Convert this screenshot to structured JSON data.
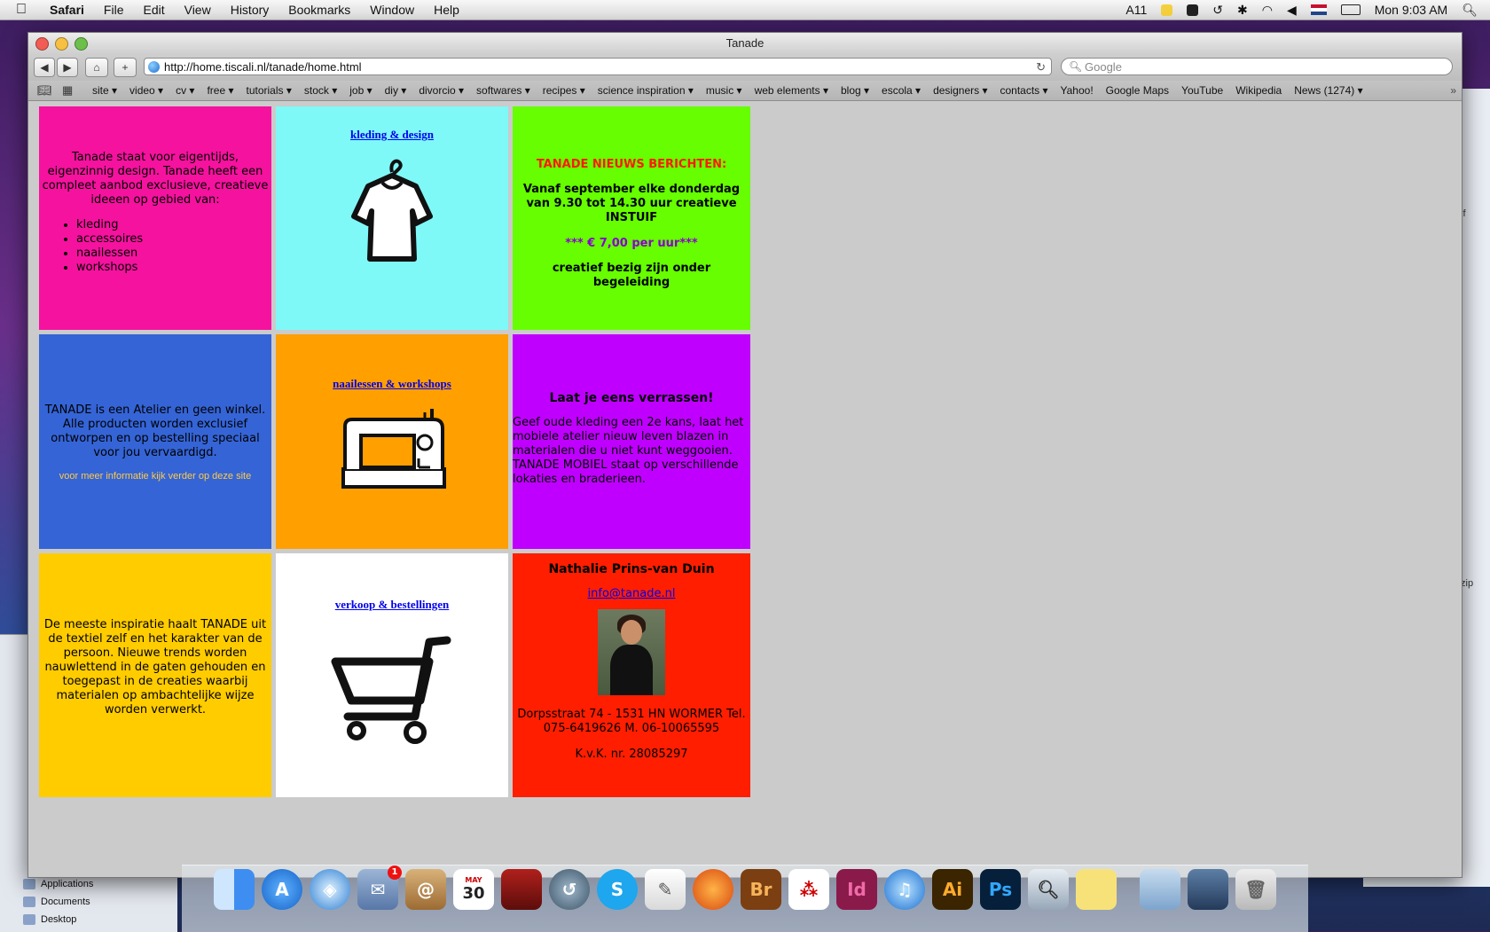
{
  "menubar": {
    "app": "Safari",
    "items": [
      "File",
      "Edit",
      "View",
      "History",
      "Bookmarks",
      "Window",
      "Help"
    ],
    "status_count": "11",
    "clock": "Mon 9:03 AM"
  },
  "window": {
    "title": "Tanade",
    "url": "http://home.tiscali.nl/tanade/home.html",
    "search_placeholder": "Google"
  },
  "bookmarks": [
    "site ▾",
    "video ▾",
    "cv ▾",
    "free ▾",
    "tutorials ▾",
    "stock ▾",
    "job ▾",
    "diy ▾",
    "divorcio ▾",
    "softwares ▾",
    "recipes ▾",
    "science inspiration ▾",
    "music ▾",
    "web elements ▾",
    "blog ▾",
    "escola ▾",
    "designers ▾",
    "contacts ▾",
    "Yahoo!",
    "Google Maps",
    "YouTube",
    "Wikipedia",
    "News (1274) ▾"
  ],
  "page": {
    "intro": "Tanade staat voor eigentijds, eigenzinnig design. Tanade heeft een compleet aanbod exclusieve, creatieve ideeen op gebied van:",
    "intro_list": [
      "kleding",
      "accessoires",
      "naailessen",
      "workshops"
    ],
    "link_kleding": "kleding & design",
    "news_head": "TANADE NIEUWS BERICHTEN:",
    "news_body": "Vanaf september elke donderdag van 9.30 tot 14.30 uur creatieve INSTUIF",
    "news_price": "*** € 7,00 per uur***",
    "news_tail": "creatief bezig zijn onder begeleiding",
    "atelier": "TANADE is een Atelier en geen winkel. Alle producten worden exclusief ontworpen en op bestelling speciaal voor jou vervaardigd.",
    "atelier_small": "voor meer informatie kijk verder op deze site",
    "link_naai": "naailessen & workshops",
    "surprise_head": "Laat je eens verrassen!",
    "surprise_body": "Geef oude kleding een 2e kans, laat het mobiele atelier nieuw leven blazen in materialen die u niet kunt weggooien. TANADE MOBIEL staat op verschillende lokaties en braderieen.",
    "inspiration": "De meeste inspiratie haalt TANADE uit de textiel zelf en het karakter van de persoon. Nieuwe trends worden nauwlettend in de gaten gehouden en toegepast in de creaties waarbij materialen op ambachtelijke wijze worden verwerkt.",
    "link_verkoop": "verkoop & bestellingen",
    "contact_name": "Nathalie Prins-van Duin",
    "contact_email": "info@tanade.nl",
    "contact_address": "Dorpsstraat 74 - 1531 HN WORMER Tel. 075-6419626 M. 06-10065595",
    "contact_kvk": "K.v.K. nr. 28085297"
  },
  "finder_sidebar": [
    "Applications",
    "Documents",
    "Desktop"
  ],
  "dock": {
    "mail_badge": "1",
    "calendar_day": "30",
    "calendar_month": "MAY",
    "apps": [
      "Finder",
      "App Store",
      "Safari",
      "Mail",
      "Address Book",
      "iCal",
      "Front Row",
      "Time Machine",
      "Skype",
      "TextEdit",
      "Firefox",
      "Bridge",
      "Acrobat",
      "InDesign",
      "iTunes",
      "Illustrator",
      "Photoshop",
      "Preview",
      "Stickies",
      "Applications",
      "Downloads",
      "Trash"
    ],
    "labels": {
      "br": "Br",
      "id": "Id",
      "ai": "Ai",
      "ps": "Ps"
    }
  },
  "colors": {
    "pink": "#f5129e",
    "cyan": "#7ff8f8",
    "green": "#66fe00",
    "blue": "#3564d6",
    "orange": "#ff9f00",
    "purple": "#c000ff",
    "yellow": "#ffcc00",
    "red": "#ff1e00"
  }
}
